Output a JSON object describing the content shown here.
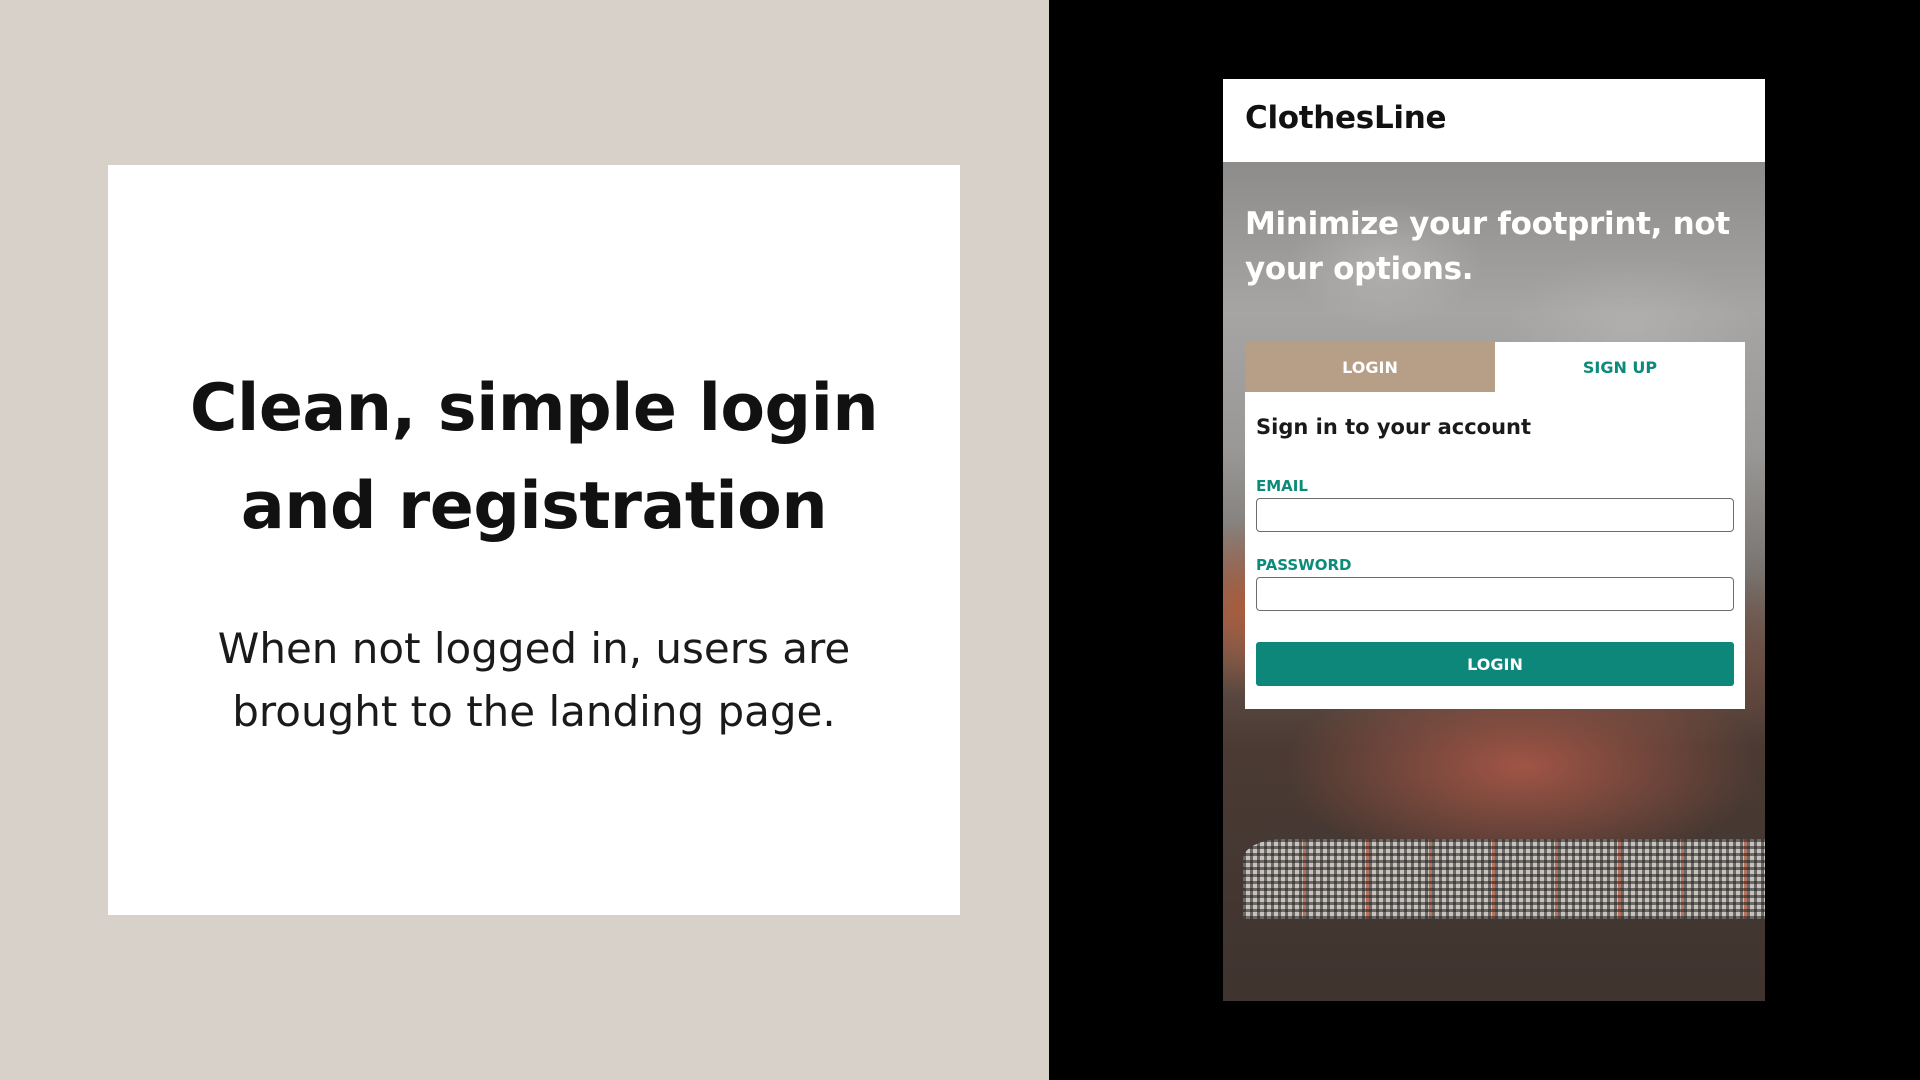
{
  "slide": {
    "heading": "Clean, simple login and registration",
    "description": "When not logged in, users are brought to the landing page."
  },
  "app": {
    "brand": "ClothesLine",
    "tagline": "Minimize your footprint, not your options.",
    "tabs": {
      "login": "LOGIN",
      "signup": "SIGN UP",
      "active": "login"
    },
    "form": {
      "title": "Sign in to your account",
      "email_label": "EMAIL",
      "email_value": "",
      "password_label": "PASSWORD",
      "password_value": "",
      "submit_label": "LOGIN"
    }
  },
  "colors": {
    "slide_background": "#d8d1ca",
    "card_background": "#ffffff",
    "accent_teal": "#0e877b",
    "tab_active_tan": "#b69e87",
    "right_background": "#000000"
  }
}
